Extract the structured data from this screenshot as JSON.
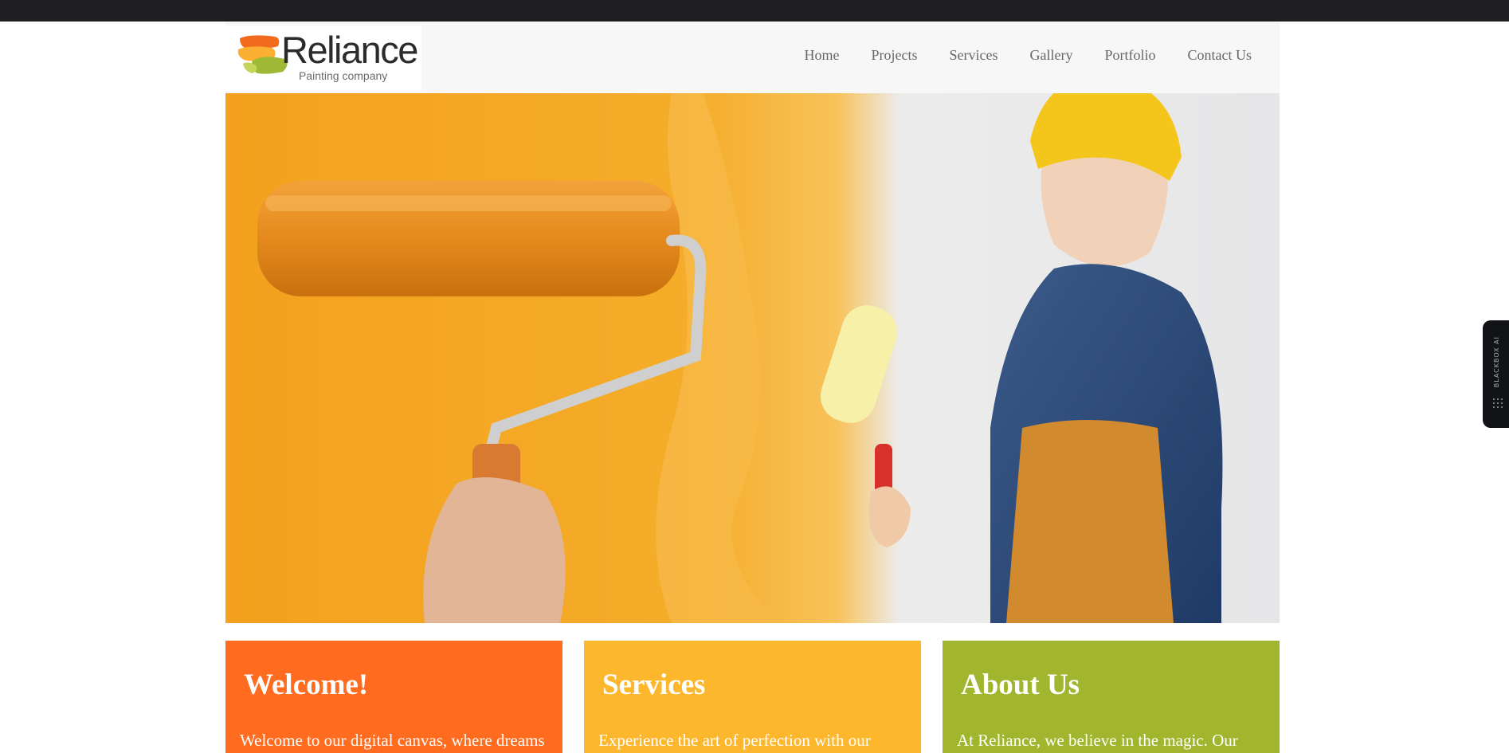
{
  "brand": {
    "name": "Reliance",
    "tagline": "Painting company"
  },
  "nav": {
    "items": [
      "Home",
      "Projects",
      "Services",
      "Gallery",
      "Portfolio",
      "Contact Us"
    ]
  },
  "cards": [
    {
      "title": "Welcome!",
      "text": "Welcome to our digital canvas, where dreams",
      "color": "#ff6c1f"
    },
    {
      "title": "Services",
      "text": "Experience the art of perfection with our",
      "color": "#fdb72d"
    },
    {
      "title": "About Us",
      "text": "At Reliance, we believe in the magic. Our",
      "color": "#a1b62e"
    }
  ],
  "widget": {
    "label": "BLACKBOX AI"
  },
  "colors": {
    "topbar": "#1e1e21",
    "header_bg": "#f7f7f7",
    "nav_text": "#666666",
    "hero_orange": "#f5a623"
  },
  "icons": {
    "logo_mark": "paint-brush-strokes-icon",
    "widget_mark": "dots-grid-icon"
  }
}
